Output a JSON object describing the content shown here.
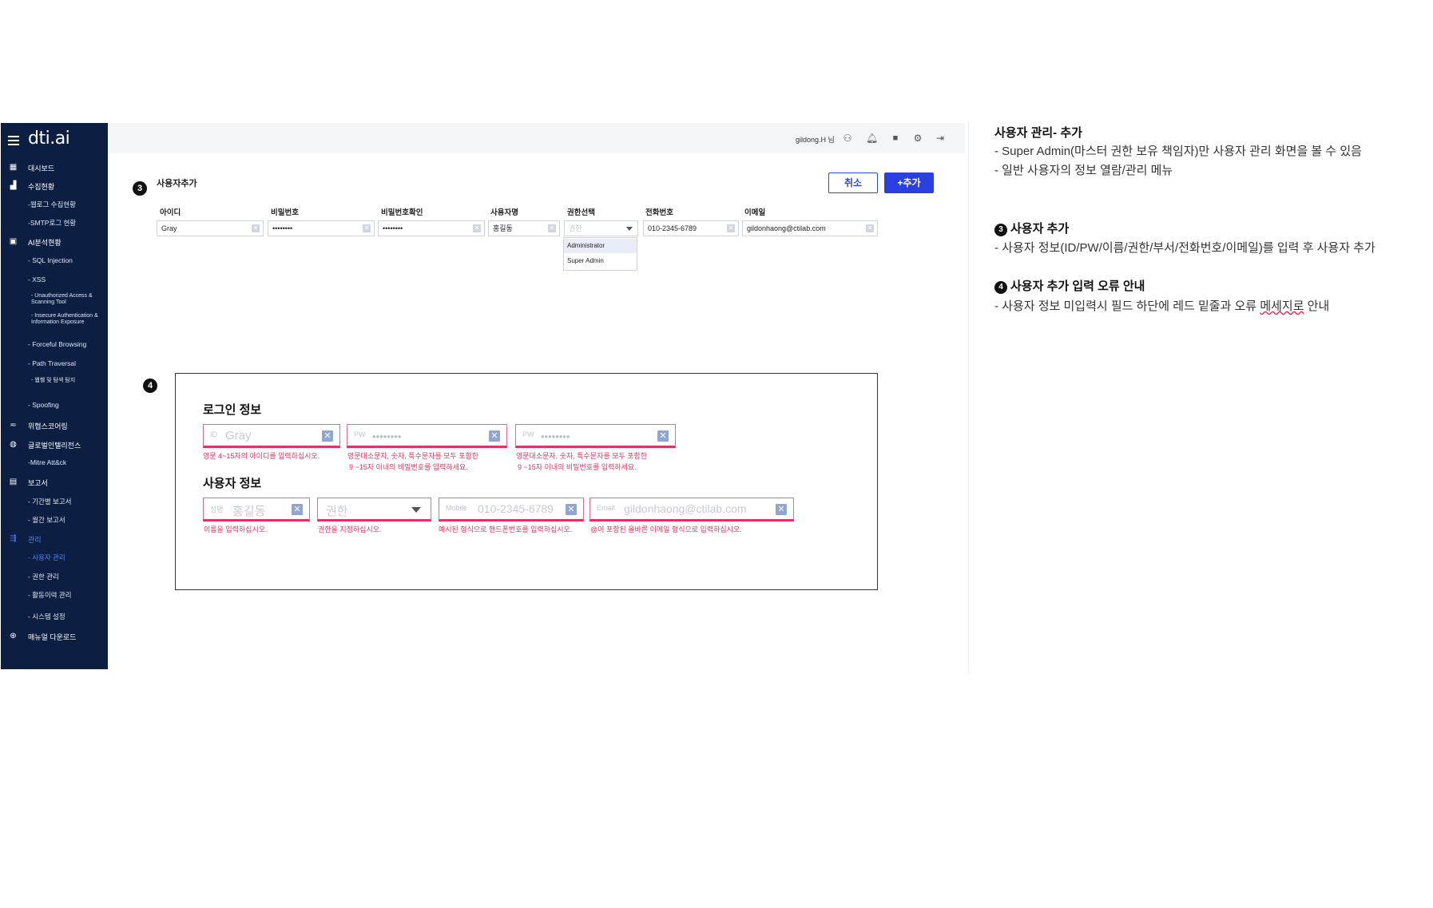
{
  "app": {
    "logo": "dti.ai"
  },
  "sidebar": {
    "items": [
      {
        "label": "대시보드",
        "icon": "grid-icon",
        "glyph": "▦",
        "level": 0
      },
      {
        "label": "수집현황",
        "icon": "bar-chart-icon",
        "glyph": "▟",
        "level": 0
      },
      {
        "label": "-웹로그 수집현황",
        "level": 1
      },
      {
        "label": "-SMTP로그 현황",
        "level": 1
      },
      {
        "label": "AI분석현황",
        "icon": "monitor-icon",
        "glyph": "▣",
        "level": 0
      },
      {
        "label": "- SQL Injection",
        "level": 1
      },
      {
        "label": "- XSS",
        "level": 1
      },
      {
        "label": "- Unauthorized Access & Scanning Tool",
        "level": 2
      },
      {
        "label": "- Insecure Authentication & Information Exposure",
        "level": 2
      },
      {
        "label": "- Forceful Browsing",
        "level": 1
      },
      {
        "label": "- Path Traversal",
        "level": 1
      },
      {
        "label": "- 웹쉘 및 탐색 탐지",
        "level": 2
      },
      {
        "label": "- Spoofing",
        "level": 1
      },
      {
        "label": "위협스코어링",
        "icon": "filter-icon",
        "glyph": "≂",
        "level": 0
      },
      {
        "label": "글로벌인텔리전스",
        "icon": "globe-icon",
        "glyph": "◍",
        "level": 0
      },
      {
        "label": "-Mitre Att&ck",
        "level": 1
      },
      {
        "label": "보고서",
        "icon": "document-icon",
        "glyph": "▤",
        "level": 0
      },
      {
        "label": "- 기간별 보고서",
        "level": 1
      },
      {
        "label": "- 월간 보고서",
        "level": 1
      },
      {
        "label": "관리",
        "icon": "settings-sliders-icon",
        "glyph": "⇶",
        "level": 0,
        "active": true
      },
      {
        "label": "- 사용자 관리",
        "level": 1,
        "active": true
      },
      {
        "label": "- 권한 관리",
        "level": 1
      },
      {
        "label": "- 활동이력 관리",
        "level": 1
      },
      {
        "label": "- 시스템 설정",
        "level": 1
      },
      {
        "label": "매뉴얼 다운로드",
        "icon": "download-circle-icon",
        "glyph": "⊕",
        "level": 0
      }
    ]
  },
  "header": {
    "user": "gildong.H 님"
  },
  "form": {
    "step_number": "3",
    "title": "사용자추가",
    "cancel_label": "취소",
    "add_label": "+추가",
    "fields": {
      "id": {
        "label": "아이디",
        "value": "Gray"
      },
      "pw": {
        "label": "비밀번호",
        "value": "••••••••"
      },
      "pw_confirm": {
        "label": "비밀번호확인",
        "value": "••••••••"
      },
      "name": {
        "label": "사용자명",
        "value": "홍길동"
      },
      "role": {
        "label": "권한선택",
        "placeholder": "권한"
      },
      "phone": {
        "label": "전화번호",
        "value": "010-2345-6789"
      },
      "email": {
        "label": "이메일",
        "value": "gildonhaong@ctilab.com"
      }
    },
    "role_options": [
      "Administrator",
      "Super Admin"
    ]
  },
  "errors": {
    "step_number": "4",
    "login_title": "로그인 정보",
    "user_title": "사용자 정보",
    "id": {
      "prefix": "ID",
      "value": "Gray",
      "msg": "영문 4~15자의 아이디를 입력하십시오."
    },
    "pw": {
      "prefix": "PW",
      "value": "••••••••",
      "msg1": "영문대소문자, 숫자, 특수문자를 모두 포함한",
      "msg2": "9 ~15자 이내의 비밀번호를 입력하세요."
    },
    "pw2": {
      "prefix": "PW",
      "value": "••••••••",
      "msg1": "영문대소문자, 숫자, 특수문자를 모두 포함한",
      "msg2": "9 ~15자 이내의 비밀번호를 입력하세요."
    },
    "name": {
      "prefix": "성명",
      "value": "홍길동",
      "msg": "이름을 입력하십시오."
    },
    "role": {
      "value": "권한",
      "msg": "권한을 지정하십시오."
    },
    "phone": {
      "prefix": "Mobile",
      "value": "010-2345-6789",
      "msg": "예시된 형식으로 핸드폰번호를 입력하십시오."
    },
    "email": {
      "prefix": "Email",
      "value": "gildonhaong@ctilab.com",
      "msg": "@이 포함된 올바른 이메일 형식으로 입력하십시오."
    }
  },
  "notes": {
    "title": "사용자 관리- 추가",
    "line1": "- Super Admin(마스터 권한 보유 책임자)만 사용자 관리 화면을 볼 수 있음",
    "line2": "- 일반 사용자의 정보 열람/관리 메뉴",
    "step3_num": "3",
    "step3_title": "사용자 추가",
    "step3_line": "- 사용자 정보(ID/PW/이름/권한/부서/전화번호/이메일)를 입력 후 사용자 추가",
    "step4_num": "4",
    "step4_title": "사용자 추가 입력 오류 안내",
    "step4_line_a": "- 사용자 정보 미입력시 필드 하단에 레드 밑줄과 오류 ",
    "step4_line_b": "메세지로",
    "step4_line_c": " 안내"
  }
}
